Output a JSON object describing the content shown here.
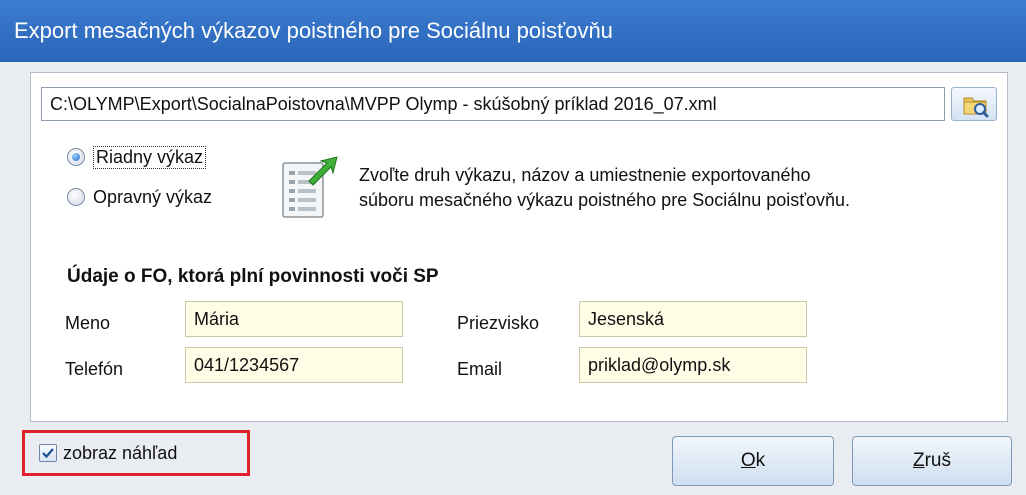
{
  "window": {
    "title": "Export mesačných výkazov poistného pre Sociálnu poisťovňu"
  },
  "file": {
    "path": "C:\\OLYMP\\Export\\SocialnaPoistovna\\MVPP Olymp - skúšobný príklad 2016_07.xml"
  },
  "report_type": {
    "options": [
      {
        "label": "Riadny výkaz",
        "checked": true
      },
      {
        "label": "Opravný výkaz",
        "checked": false
      }
    ]
  },
  "info": {
    "line1": "Zvoľte druh výkazu, názov a umiestnenie exportovaného",
    "line2": "súboru mesačného výkazu poistného pre Sociálnu poisťovňu."
  },
  "person": {
    "section_title": "Údaje o FO, ktorá plní povinnosti voči SP",
    "name_label": "Meno",
    "name_value": "Mária",
    "surname_label": "Priezvisko",
    "surname_value": "Jesenská",
    "phone_label": "Telefón",
    "phone_value": "041/1234567",
    "email_label": "Email",
    "email_value": "priklad@olymp.sk"
  },
  "preview": {
    "label": "zobraz náhľad",
    "checked": true
  },
  "buttons": {
    "ok_mnemonic": "O",
    "ok_rest": "k",
    "cancel_mnemonic": "Z",
    "cancel_rest": "ruš"
  },
  "colors": {
    "titlebar": "#2f6fc3",
    "field_bg": "#fffde6",
    "highlight": "#e0202a"
  }
}
